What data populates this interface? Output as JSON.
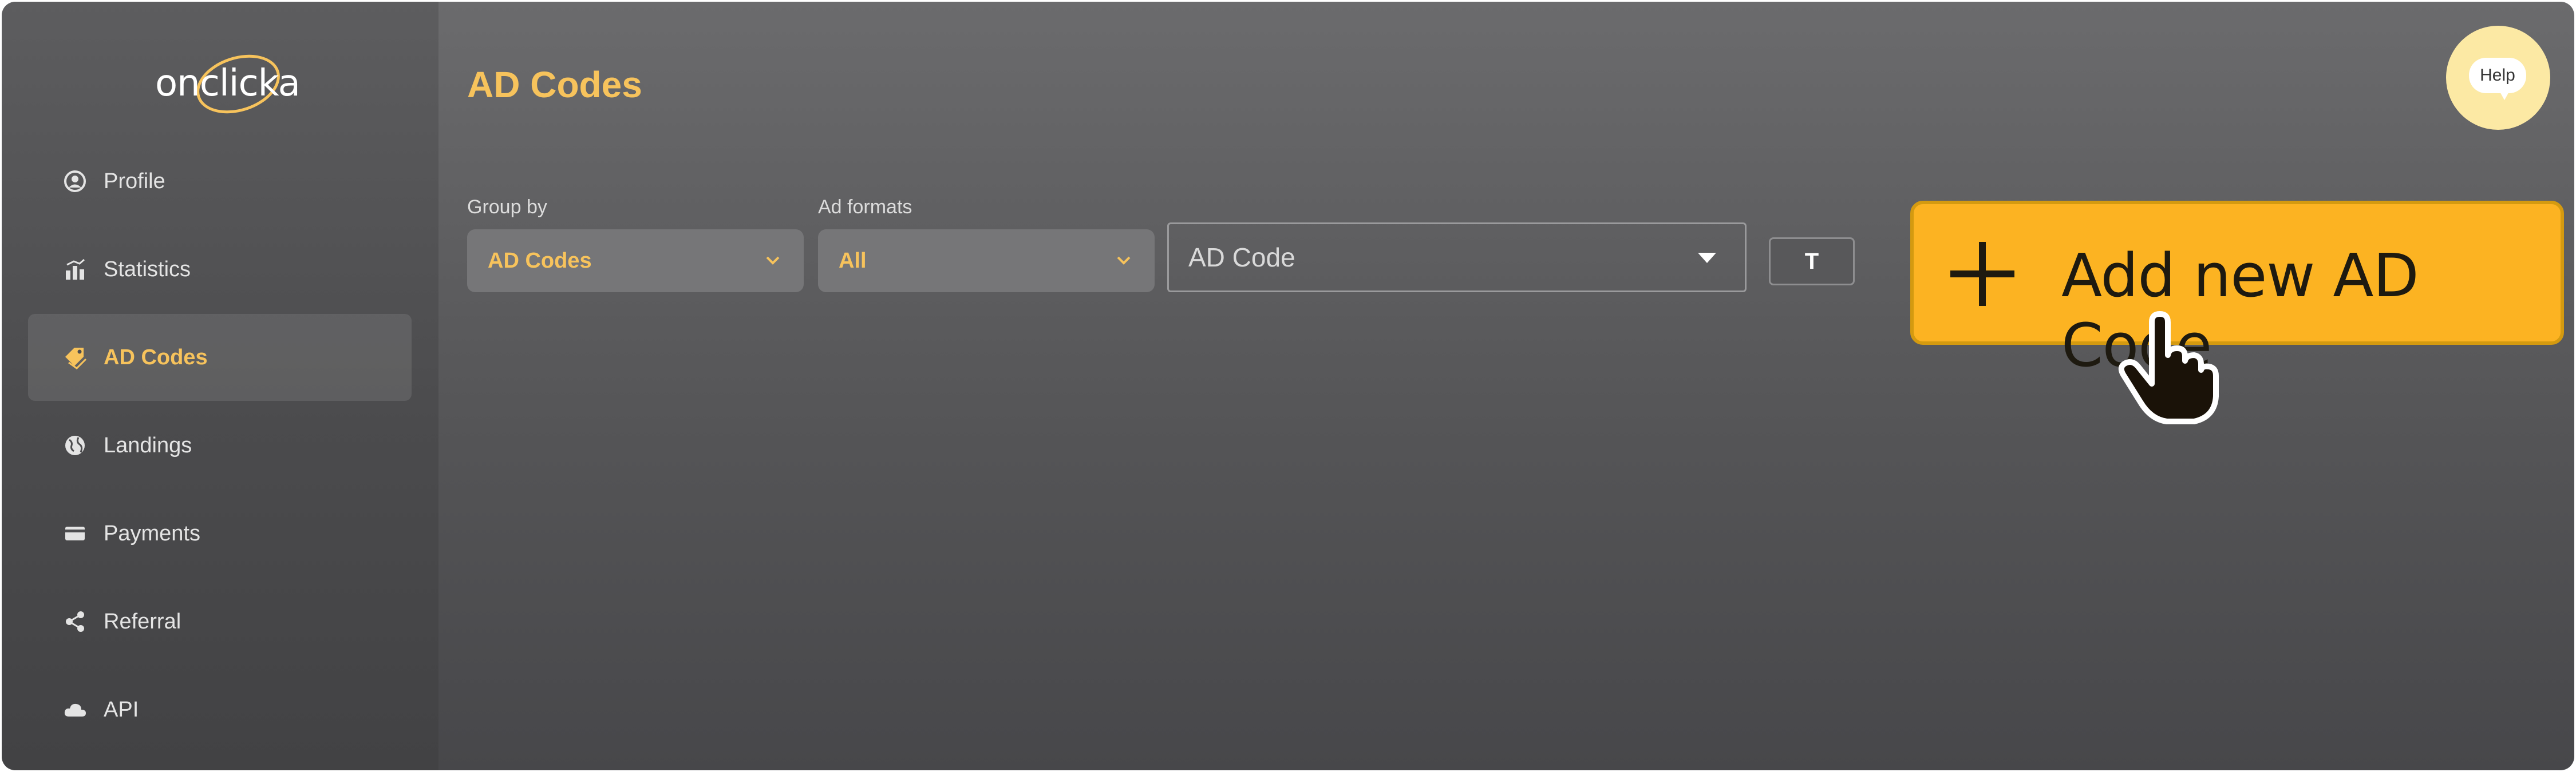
{
  "app": {
    "logo_text": "onclicka",
    "accent": "#f7c35c",
    "button_color": "#fcb322"
  },
  "sidebar": {
    "items": [
      {
        "label": "Profile",
        "icon": "user-circle-icon",
        "active": false
      },
      {
        "label": "Statistics",
        "icon": "bar-chart-icon",
        "active": false
      },
      {
        "label": "AD Codes",
        "icon": "tag-icon",
        "active": true
      },
      {
        "label": "Landings",
        "icon": "globe-icon",
        "active": false
      },
      {
        "label": "Payments",
        "icon": "credit-card-icon",
        "active": false
      },
      {
        "label": "Referral",
        "icon": "share-icon",
        "active": false
      },
      {
        "label": "API",
        "icon": "cloud-icon",
        "active": false
      }
    ]
  },
  "main": {
    "title": "AD Codes",
    "filters": {
      "group_by_label": "Group by",
      "group_by_value": "AD Codes",
      "ad_formats_label": "Ad formats",
      "ad_formats_value": "All",
      "ad_code_placeholder": "AD Code",
      "toggle_label": "T"
    },
    "add_button_label": "Add new AD Code",
    "help_label": "Help"
  }
}
